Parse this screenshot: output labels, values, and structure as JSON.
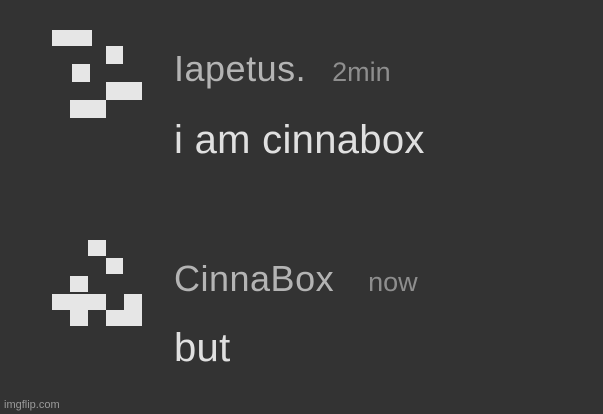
{
  "messages": [
    {
      "author": "Iapetus.",
      "timestamp": "2min",
      "text": "i am cinnabox",
      "avatar_icon": "white-pixel-block-avatar-icon"
    },
    {
      "author": "CinnaBox",
      "timestamp": "now",
      "text": "but",
      "avatar_icon": "white-pixel-block-avatar-icon"
    }
  ],
  "watermark": "imgflip.com",
  "colors": {
    "background": "#333333",
    "author": "#b4b4b4",
    "timestamp": "#8e8e8e",
    "message_text": "#e0e0e0",
    "avatar_pixels": "#e6e6e6"
  }
}
